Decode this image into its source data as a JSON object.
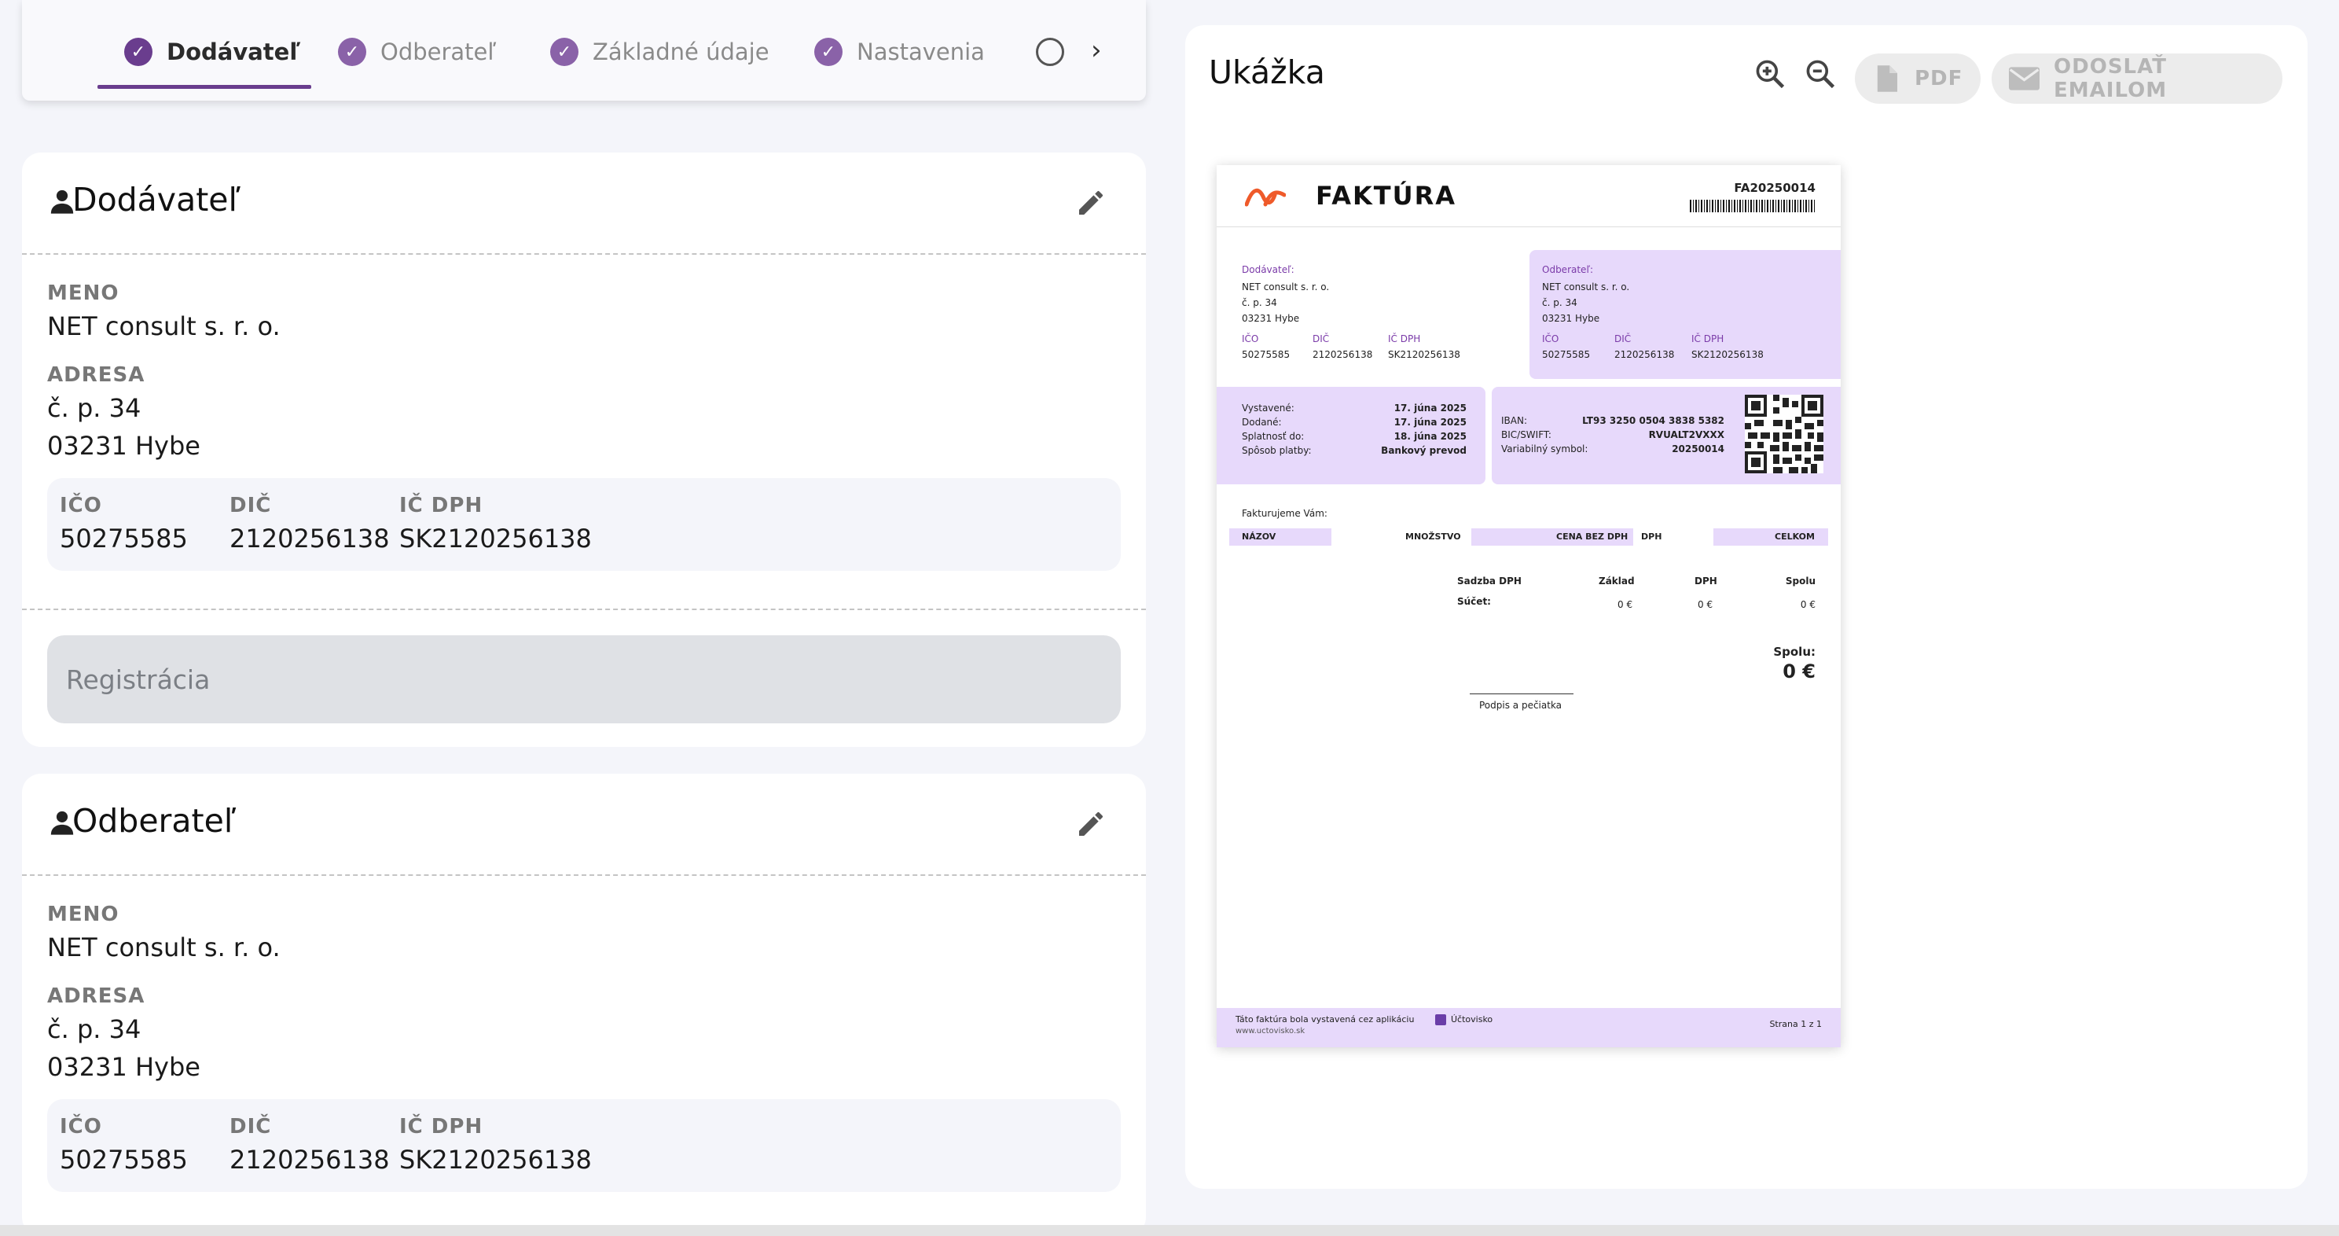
{
  "stepper": {
    "steps": [
      {
        "label": "Dodávateľ",
        "state": "done",
        "active": true
      },
      {
        "label": "Odberateľ",
        "state": "done"
      },
      {
        "label": "Základné údaje",
        "state": "done"
      },
      {
        "label": "Nastavenia",
        "state": "done"
      },
      {
        "label": "",
        "state": "pending"
      }
    ],
    "accent": "#6a3d8e"
  },
  "supplier": {
    "title": "Dodávateľ",
    "name_label": "MENO",
    "name": "NET consult s. r. o.",
    "address_label": "ADRESA",
    "address_line1": "č. p. 34",
    "address_line2": "03231 Hybe",
    "ico_label": "IČO",
    "ico": "50275585",
    "dic_label": "DIČ",
    "dic": "2120256138",
    "icdph_label": "IČ DPH",
    "icdph": "SK2120256138",
    "registration_placeholder": "Registrácia"
  },
  "customer": {
    "title": "Odberateľ",
    "name_label": "MENO",
    "name": "NET consult s. r. o.",
    "address_label": "ADRESA",
    "address_line1": "č. p. 34",
    "address_line2": "03231 Hybe",
    "ico_label": "IČO",
    "ico": "50275585",
    "dic_label": "DIČ",
    "dic": "2120256138",
    "icdph_label": "IČ DPH",
    "icdph": "SK2120256138"
  },
  "preview": {
    "title": "Ukážka",
    "pdf_label": "PDF",
    "email_label": "ODOSLAŤ EMAILOM"
  },
  "invoice": {
    "title": "FAKTÚRA",
    "number": "FA20250014",
    "supplier_label": "Dodávateľ:",
    "customer_label": "Odberateľ:",
    "name": "NET consult s. r. o.",
    "address_line1": "č. p. 34",
    "address_line2": "03231 Hybe",
    "ico_label": "IČO",
    "dic_label": "DIČ",
    "icdph_label": "IČ DPH",
    "ico": "50275585",
    "dic": "2120256138",
    "icdph": "SK2120256138",
    "issued_label": "Vystavené:",
    "issued": "17. júna 2025",
    "delivered_label": "Dodané:",
    "delivered": "17. júna 2025",
    "due_label": "Splatnosť do:",
    "due": "18. júna 2025",
    "payment_label": "Spôsob platby:",
    "payment": "Bankový prevod",
    "iban_label": "IBAN:",
    "iban": "LT93 3250 0504 3838 5382",
    "bic_label": "BIC/SWIFT:",
    "bic": "RVUALT2VXXX",
    "vs_label": "Variabilný symbol:",
    "vs": "20250014",
    "intro": "Fakturujeme Vám:",
    "col_name": "NÁZOV",
    "col_qty": "MNOŽSTVO",
    "col_price": "CENA BEZ DPH",
    "col_vat": "DPH",
    "col_total": "CELKOM",
    "sum_rate": "Sadzba DPH",
    "sum_base": "Základ",
    "sum_vat": "DPH",
    "sum_total": "Spolu",
    "sum_row_label": "Súčet:",
    "sum_base_val": "0 €",
    "sum_vat_val": "0 €",
    "sum_total_val": "0 €",
    "grand_label": "Spolu:",
    "grand_val": "0 €",
    "signature": "Podpis a pečiatka",
    "footer_text": "Táto faktúra bola vystavená cez aplikáciu",
    "footer_brand": "Účtovisko",
    "footer_url": "www.uctovisko.sk",
    "page": "Strana 1 z 1"
  }
}
